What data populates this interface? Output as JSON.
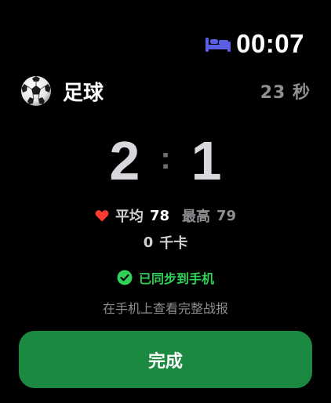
{
  "status_bar": {
    "time": "00:07",
    "sleep_icon": "bed-icon"
  },
  "workout": {
    "sport_icon": "soccer-ball-icon",
    "sport_name": "足球",
    "elapsed": "23 秒"
  },
  "score": {
    "home": "2",
    "separator": ":",
    "away": "1"
  },
  "heart_rate": {
    "icon": "heart-icon",
    "avg_label": "平均",
    "avg_value": "78",
    "max_label": "最高",
    "max_value": "79"
  },
  "calories": {
    "value": "0",
    "unit": "千卡"
  },
  "sync": {
    "icon": "check-circle-icon",
    "text": "已同步到手机"
  },
  "hint": "在手机上查看完整战报",
  "done_button": {
    "label": "完成"
  },
  "colors": {
    "background": "#000000",
    "accent_green": "#30d158",
    "button_green": "#1b8a40",
    "heart_red": "#ff3b30",
    "bed_blue": "#5b5fe6",
    "muted_gray": "#8e8e93"
  }
}
